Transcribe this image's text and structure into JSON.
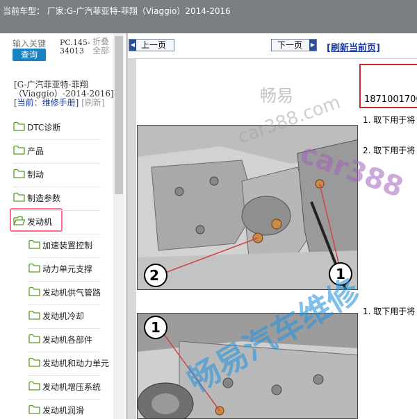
{
  "titlebar": {
    "text": "当前车型： 厂家:G-广汽菲亚特-菲翔（Viaggio）2014-2016"
  },
  "search": {
    "placeholder": "输入关键",
    "button_label": "查询"
  },
  "pc_code": "PC.145-34013",
  "fold_all_label": "折叠全部",
  "tree_header": {
    "title": "[G-广汽菲亚特-菲翔（Viaggio）-2014-2016]",
    "current_label": "[当前：维修手册]",
    "refresh_label": "[刷新]"
  },
  "tree_items": [
    {
      "label": "DTC诊断",
      "level": 1
    },
    {
      "label": "产品",
      "level": 1
    },
    {
      "label": "制动",
      "level": 1
    },
    {
      "label": "制造参数",
      "level": 1
    },
    {
      "label": "发动机",
      "level": 1,
      "selected": true
    },
    {
      "label": "加速装置控制",
      "level": 2
    },
    {
      "label": "动力单元支撑",
      "level": 2
    },
    {
      "label": "发动机供气管路",
      "level": 2
    },
    {
      "label": "发动机冷却",
      "level": 2
    },
    {
      "label": "发动机各部件",
      "level": 2
    },
    {
      "label": "发动机和动力单元",
      "level": 2
    },
    {
      "label": "发动机增压系统",
      "level": 2
    },
    {
      "label": "发动机润滑",
      "level": 2
    }
  ],
  "nav": {
    "prev_label": "上一页",
    "next_label": "下一页",
    "refresh_page_label": "[刷新当前页]"
  },
  "content": {
    "part_number": "1871001700",
    "step1": "1. 取下用于将",
    "step2": "2. 取下用于将",
    "step3": "1. 取下用于将",
    "callouts": [
      "2",
      "1",
      "1"
    ]
  },
  "watermarks": [
    "畅易",
    "car388.com",
    "car388",
    "畅易汽车维修"
  ],
  "colors": {
    "title_bg": "#7a7f84",
    "accent_blue": "#1883c3",
    "link_blue": "#1a3a9e",
    "selection_border": "#ff6b8a",
    "folder_green": "#5a9a2a"
  }
}
